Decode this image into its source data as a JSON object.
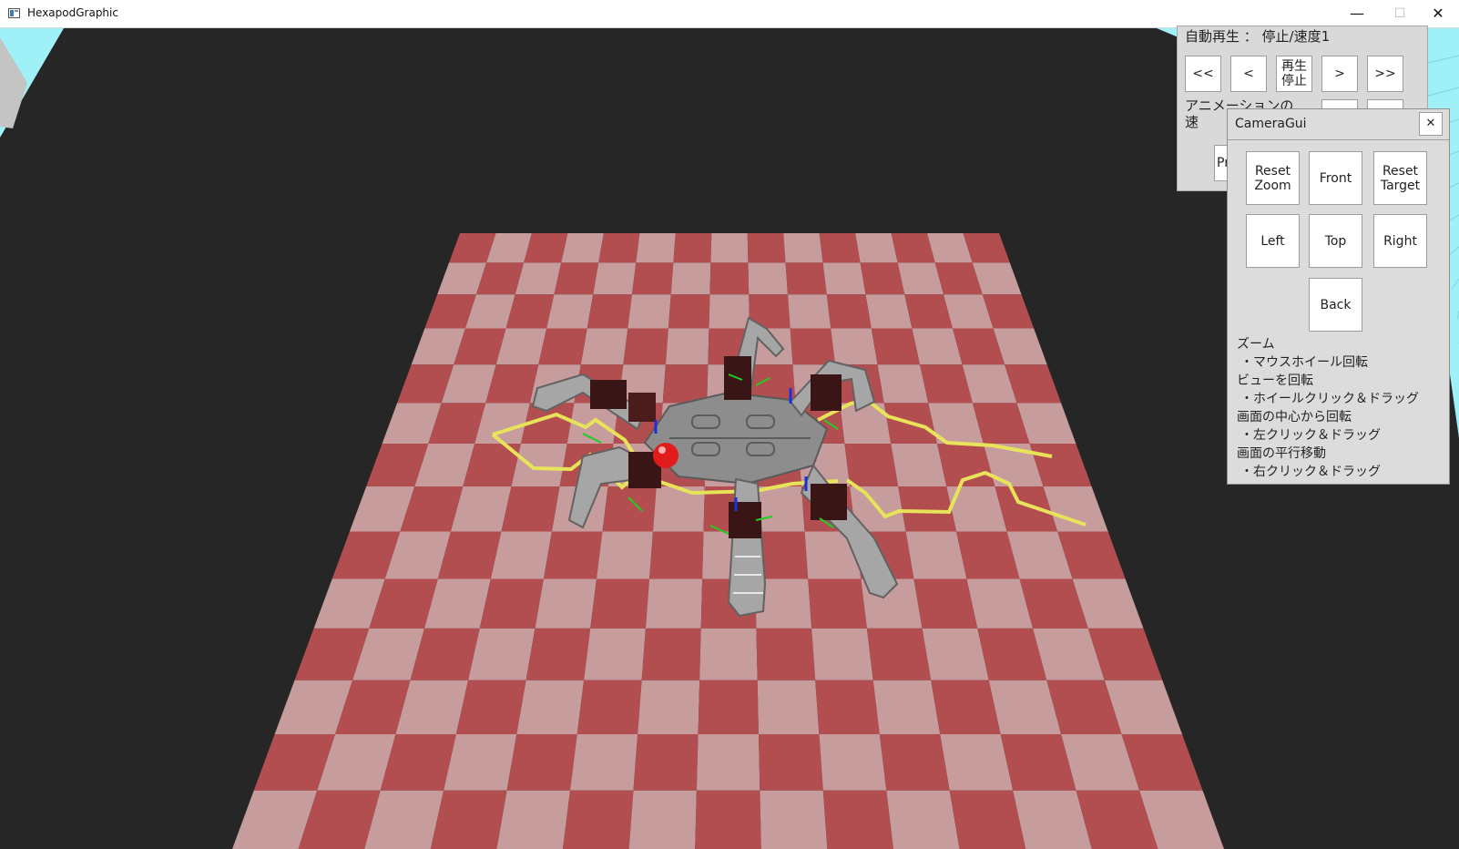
{
  "window": {
    "title": "HexapodGraphic",
    "minimize_glyph": "—",
    "maximize_glyph": "☐",
    "close_glyph": "✕"
  },
  "playback_panel": {
    "status": "自動再生 ： 停止/速度1",
    "first_label": "<<",
    "prev_label": "<",
    "play_stop_label": "再生\n停止",
    "next_label": ">",
    "last_label": ">>",
    "anim_speed_label": "アニメーションの\n速",
    "partial_button_label": "Pr"
  },
  "camera_gui": {
    "title": "CameraGui",
    "close_glyph": "✕",
    "reset_zoom": "Reset\nZoom",
    "front": "Front",
    "reset_target": "Reset\nTarget",
    "left": "Left",
    "top": "Top",
    "right": "Right",
    "back": "Back",
    "help": [
      "ズーム",
      "・マウスホイール回転",
      "ビューを回転",
      "・ホイールクリック＆ドラッグ",
      "画面の中心から回転",
      "・左クリック＆ドラッグ",
      "画面の平行移動",
      "・右クリック＆ドラッグ"
    ]
  },
  "scene": {
    "checker_colors": [
      "#b34e50",
      "#c69c9d"
    ],
    "background_color": "#262626",
    "trajectory_color": "#e8e45a",
    "body_marker_color": "#e11c1c",
    "robot_color": "#8a8a8a",
    "servo_color": "#3a1515",
    "axis_green": "#22cc22",
    "axis_blue": "#1f2fd8",
    "sky_color": "#9ff0f7"
  }
}
